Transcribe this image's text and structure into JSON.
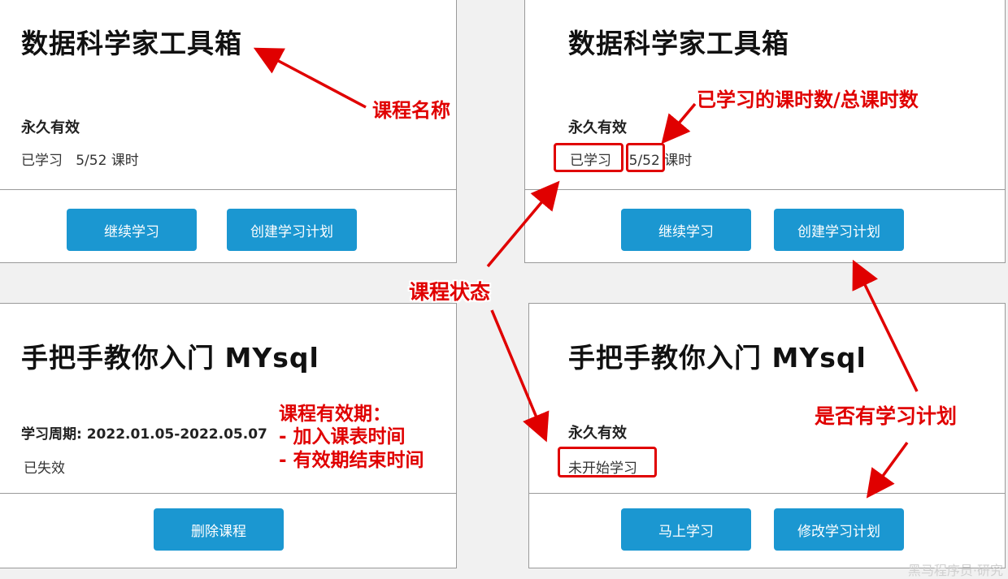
{
  "cards": [
    {
      "title": "数据科学家工具箱",
      "validity": "永久有效",
      "status_label": "已学习",
      "progress": "5/52",
      "unit": "课时",
      "buttons": [
        "继续学习",
        "创建学习计划"
      ]
    },
    {
      "title": "数据科学家工具箱",
      "validity": "永久有效",
      "status_label": "已学习",
      "progress": "5/52",
      "unit": "课时",
      "buttons": [
        "继续学习",
        "创建学习计划"
      ]
    },
    {
      "title": "手把手教你入门 MYsql",
      "validity": "学习周期: 2022.01.05-2022.05.07",
      "status_label": "已失效",
      "buttons": [
        "删除课程"
      ]
    },
    {
      "title": "手把手教你入门 MYsql",
      "validity": "永久有效",
      "status_label": "未开始学习",
      "buttons": [
        "马上学习",
        "修改学习计划"
      ]
    }
  ],
  "annotations": {
    "course_name": "课程名称",
    "lessons_ratio": "已学习的课时数/总课时数",
    "course_status": "课程状态",
    "validity_heading": "课程有效期：",
    "validity_line1": "- 加入课表时间",
    "validity_line2": "- 有效期结束时间",
    "has_plan": "是否有学习计划"
  },
  "watermark": "黑马程序员·研究",
  "colors": {
    "button": "#1b97d1",
    "annotation": "#e00000",
    "background": "#f1f1f1"
  }
}
